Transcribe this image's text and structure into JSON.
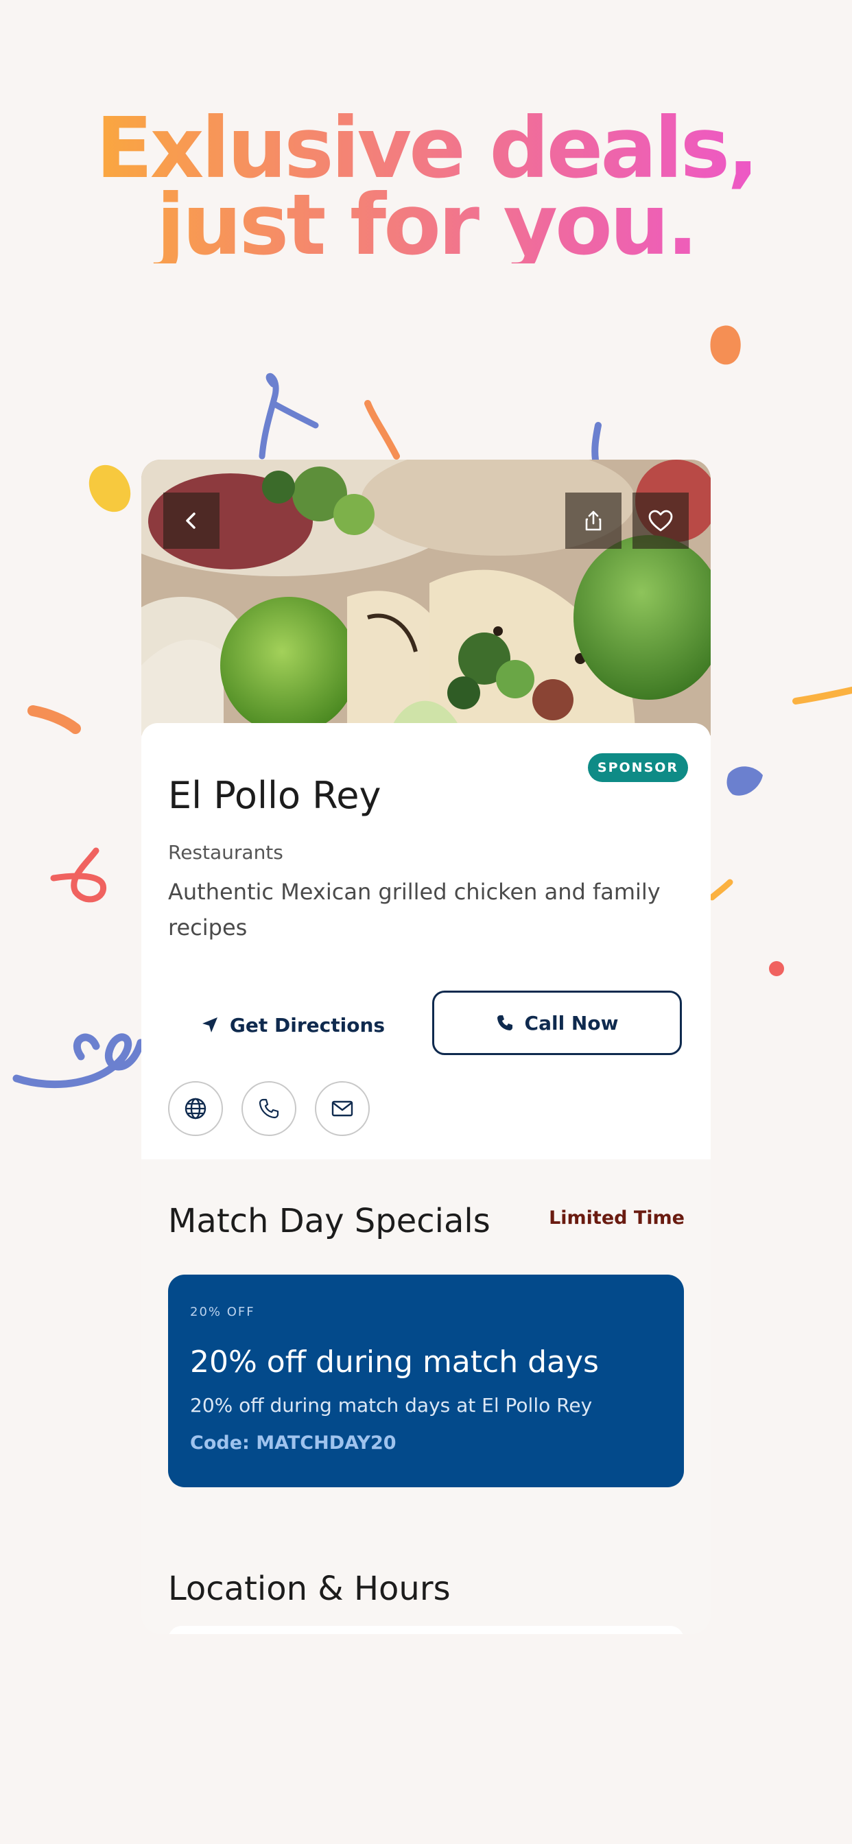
{
  "headline": {
    "line1": "Exlusive deals,",
    "line2": "just for you."
  },
  "colors": {
    "gradient_start": "#fcb52b",
    "gradient_end": "#ec4fd8",
    "page_background": "#f9f5f3",
    "sponsor_badge": "#0e8b86",
    "deal_card": "#034a8b",
    "navy_text": "#0f2a4e",
    "limited_time": "#6a1b10"
  },
  "hero": {
    "image": "tacos-with-lime-photo",
    "back_icon": "chevron-left-icon",
    "share_icon": "share-icon",
    "favorite_icon": "heart-icon"
  },
  "business": {
    "badge": "SPONSOR",
    "name": "El Pollo Rey",
    "category": "Restaurants",
    "description": "Authentic Mexican grilled chicken and family recipes"
  },
  "actions": {
    "directions_label": "Get Directions",
    "directions_icon": "navigation-arrow-icon",
    "call_label": "Call Now",
    "call_icon": "phone-icon",
    "quick_links": [
      "globe-icon",
      "phone-icon",
      "mail-icon"
    ]
  },
  "specials": {
    "title": "Match Day Specials",
    "tag": "Limited Time",
    "deal": {
      "eyebrow": "20% OFF",
      "title": "20% off during match days",
      "subtitle": "20% off during match days at El Pollo Rey",
      "code": "Code: MATCHDAY20"
    }
  },
  "location": {
    "title": "Location & Hours"
  }
}
